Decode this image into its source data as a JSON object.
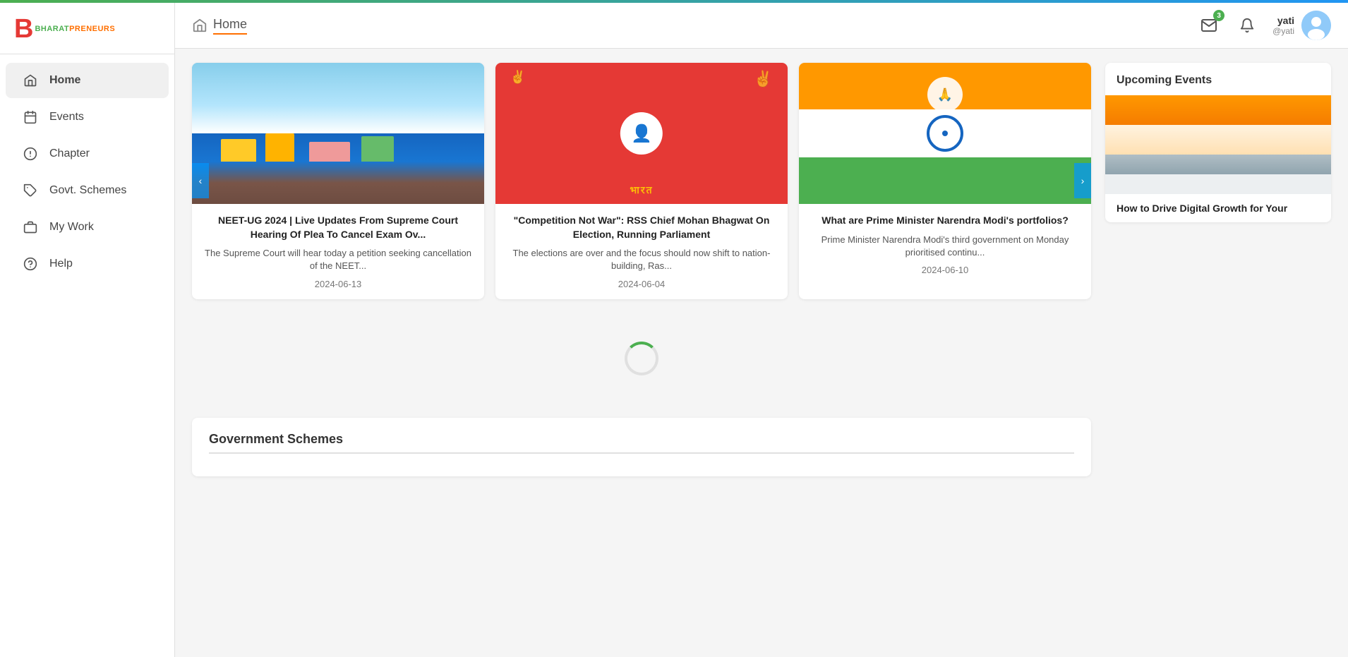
{
  "topbar": {},
  "sidebar": {
    "logo": {
      "letter": "B",
      "brand_green": "BHARAT",
      "brand_orange": "PRENEURS"
    },
    "nav_items": [
      {
        "id": "home",
        "label": "Home",
        "icon": "home-icon",
        "active": true
      },
      {
        "id": "events",
        "label": "Events",
        "icon": "events-icon",
        "active": false
      },
      {
        "id": "chapter",
        "label": "Chapter",
        "icon": "chapter-icon",
        "active": false
      },
      {
        "id": "govt-schemes",
        "label": "Govt. Schemes",
        "icon": "tag-icon",
        "active": false
      },
      {
        "id": "my-work",
        "label": "My Work",
        "icon": "briefcase-icon",
        "active": false
      },
      {
        "id": "help",
        "label": "Help",
        "icon": "help-icon",
        "active": false
      }
    ]
  },
  "header": {
    "title": "Home",
    "home_icon": "home-icon",
    "messages_badge": "3",
    "user_name": "yati",
    "user_handle": "@yati"
  },
  "news_cards": [
    {
      "title": "NEET-UG 2024 | Live Updates From Supreme Court Hearing Of Plea To Cancel Exam Ov...",
      "description": "The Supreme Court will hear today a petition seeking cancellation of the NEET...",
      "date": "2024-06-13",
      "image_type": "kashmir"
    },
    {
      "title": "\"Competition Not War\": RSS Chief Mohan Bhagwat On Election, Running Parliament",
      "description": "The elections are over and the focus should now shift to nation-building, Ras...",
      "date": "2024-06-04",
      "image_type": "modi-rally"
    },
    {
      "title": "What are Prime Minister Narendra Modi's portfolios?",
      "description": "Prime Minister Narendra Modi's third government on Monday prioritised continu...",
      "date": "2024-06-10",
      "image_type": "modi-flag"
    }
  ],
  "carousel_prev": "‹",
  "carousel_next": "›",
  "loading_section": {
    "visible": true
  },
  "government_schemes": {
    "title": "Government Schemes"
  },
  "upcoming_events": {
    "title": "Upcoming Events",
    "event_title": "How to Drive Digital Growth for Your"
  }
}
